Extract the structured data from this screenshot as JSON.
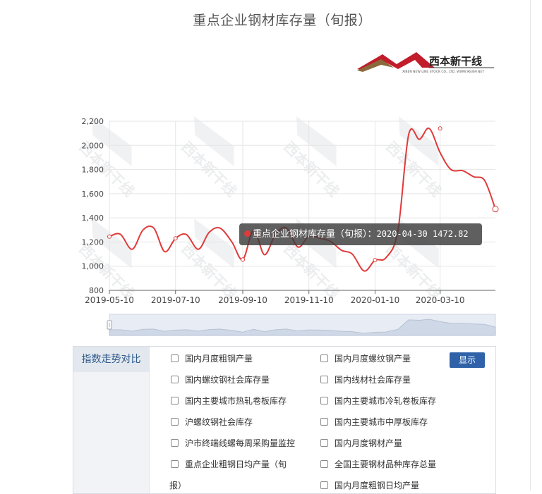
{
  "title": "重点企业钢材库存量（旬报）",
  "logo_text": "西本新干线",
  "logo_subtext": "XIBEN NEW LINE STOCK CO., LTD.  WWW.96369.NET",
  "watermark_text": "西本新干线",
  "colors": {
    "line": "#e03a3a",
    "grid": "#e5e5e5",
    "accent": "#2f62a8"
  },
  "chart_data": {
    "type": "line",
    "title": "重点企业钢材库存量（旬报）",
    "xlabel": "",
    "ylabel": "",
    "ylim": [
      800,
      2200
    ],
    "yticks": [
      800,
      1000,
      1200,
      1400,
      1600,
      1800,
      2000,
      2200
    ],
    "ytick_labels": [
      "800",
      "1,000",
      "1,200",
      "1,400",
      "1,600",
      "1,800",
      "2,000",
      "2,200"
    ],
    "xtick_labels": [
      "2019-05-10",
      "2019-07-10",
      "2019-09-10",
      "2019-11-10",
      "2020-01-10",
      "2020-03-10"
    ],
    "grid": true,
    "series": [
      {
        "name": "重点企业钢材库存量（旬报）",
        "x": [
          "2019-05-10",
          "2019-05-20",
          "2019-05-31",
          "2019-06-10",
          "2019-06-20",
          "2019-06-30",
          "2019-07-10",
          "2019-07-20",
          "2019-07-31",
          "2019-08-10",
          "2019-08-20",
          "2019-08-31",
          "2019-09-10",
          "2019-09-20",
          "2019-09-30",
          "2019-10-10",
          "2019-10-20",
          "2019-10-31",
          "2019-11-10",
          "2019-11-20",
          "2019-11-30",
          "2019-12-10",
          "2019-12-20",
          "2019-12-31",
          "2020-01-10",
          "2020-01-20",
          "2020-01-31",
          "2020-02-10",
          "2020-02-20",
          "2020-02-29",
          "2020-03-10",
          "2020-03-20",
          "2020-03-31",
          "2020-04-10",
          "2020-04-20",
          "2020-04-30"
        ],
        "y": [
          1245,
          1265,
          1140,
          1300,
          1315,
          1120,
          1230,
          1262,
          1140,
          1280,
          1315,
          1200,
          1055,
          1300,
          1095,
          1260,
          1318,
          1158,
          1250,
          1232,
          1205,
          1132,
          1100,
          960,
          1050,
          1070,
          1290,
          2090,
          2050,
          2140,
          1940,
          1800,
          1790,
          1740,
          1710,
          1472.82
        ]
      }
    ],
    "markers": [
      {
        "x": "2019-05-10",
        "y": 1245
      },
      {
        "x": "2019-07-10",
        "y": 1230
      },
      {
        "x": "2019-09-10",
        "y": 1055
      },
      {
        "x": "2020-01-10",
        "y": 1050
      },
      {
        "x": "2020-03-10",
        "y": 2140
      },
      {
        "x": "2020-04-30",
        "y": 1472.82
      }
    ],
    "tooltip": {
      "series_name": "重点企业钢材库存量（旬报）",
      "date": "2020-04-30",
      "value": "1472.82"
    }
  },
  "panel": {
    "header": "指数走势对比",
    "show_button": "显示",
    "options": [
      "国内月度粗钢产量",
      "国内月度螺纹钢产量",
      "国内螺纹钢社会库存量",
      "国内线材社会库存量",
      "国内主要城市热轧卷板库存",
      "国内主要城市冷轧卷板库存",
      "沪螺纹钢社会库存",
      "国内主要城市中厚板库存",
      "沪市终端线螺每周采购量监控",
      "国内月度钢材产量",
      "重点企业粗钢日均产量（旬",
      "全国主要钢材品种库存总量",
      "报）",
      "国内月度粗钢日均产量"
    ]
  }
}
